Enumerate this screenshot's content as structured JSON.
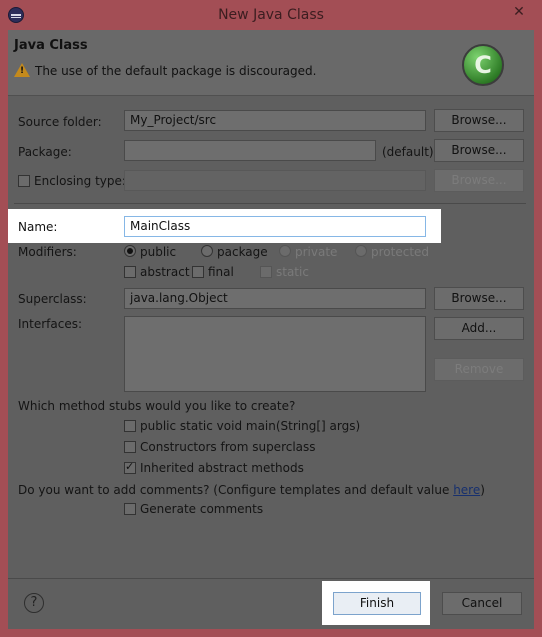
{
  "window": {
    "title": "New Java Class",
    "close_label": "✕"
  },
  "header": {
    "title": "Java Class",
    "message": "The use of the default package is discouraged.",
    "logo_letter": "C"
  },
  "form": {
    "source_folder": {
      "label": "Source folder:",
      "value": "My_Project/src",
      "browse": "Browse..."
    },
    "package": {
      "label": "Package:",
      "value": "",
      "default_text": "(default)",
      "browse": "Browse..."
    },
    "enclosing_type": {
      "label": "Enclosing type:",
      "value": "",
      "checked": false,
      "browse": "Browse..."
    },
    "name": {
      "label": "Name:",
      "value": "MainClass"
    },
    "modifiers": {
      "label": "Modifiers:",
      "access": [
        {
          "label": "public",
          "checked": true,
          "enabled": true
        },
        {
          "label": "package",
          "checked": false,
          "enabled": true
        },
        {
          "label": "private",
          "checked": false,
          "enabled": false
        },
        {
          "label": "protected",
          "checked": false,
          "enabled": false
        }
      ],
      "flags": [
        {
          "label": "abstract",
          "checked": false,
          "enabled": true
        },
        {
          "label": "final",
          "checked": false,
          "enabled": true
        },
        {
          "label": "static",
          "checked": false,
          "enabled": false
        }
      ]
    },
    "superclass": {
      "label": "Superclass:",
      "value": "java.lang.Object",
      "browse": "Browse..."
    },
    "interfaces": {
      "label": "Interfaces:",
      "add": "Add...",
      "remove": "Remove"
    },
    "stubs": {
      "question": "Which method stubs would you like to create?",
      "options": [
        {
          "label": "public static void main(String[] args)",
          "checked": false
        },
        {
          "label": "Constructors from superclass",
          "checked": false
        },
        {
          "label": "Inherited abstract methods",
          "checked": true
        }
      ]
    },
    "comments": {
      "question": "Do you want to add comments? (Configure templates and default value ",
      "link": "here",
      "question_end": ")",
      "option": {
        "label": "Generate comments",
        "checked": false
      }
    }
  },
  "footer": {
    "help": "?",
    "finish": "Finish",
    "cancel": "Cancel"
  }
}
